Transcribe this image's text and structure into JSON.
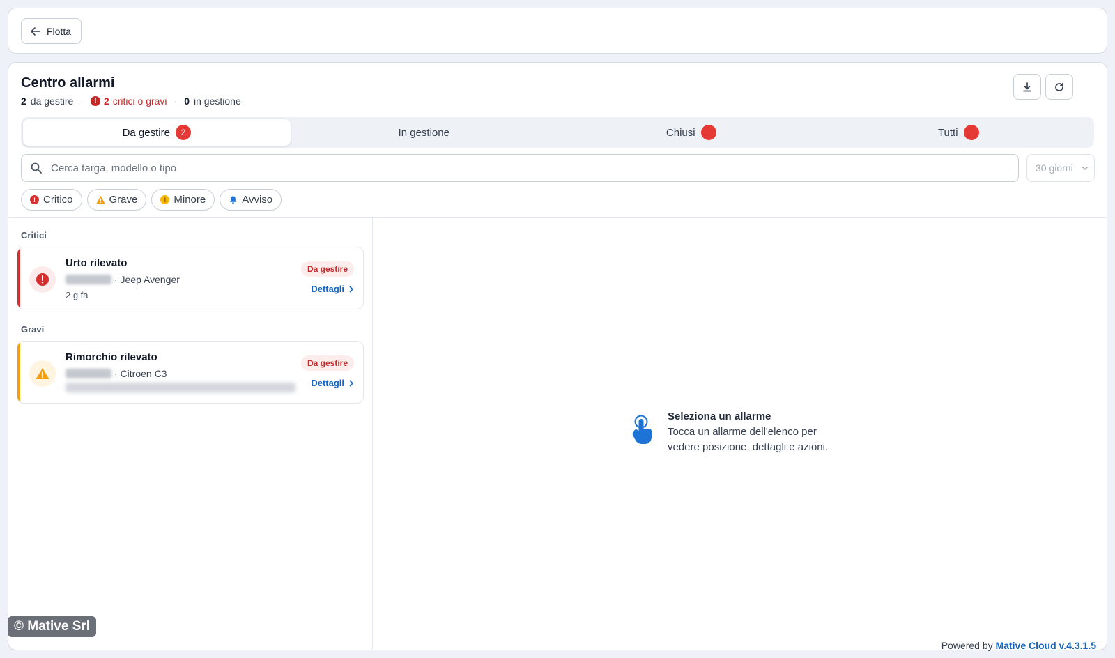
{
  "header": {
    "back_label": "Flotta"
  },
  "page": {
    "title": "Centro allarmi",
    "summary": {
      "to_handle_count": "2",
      "to_handle_label": "da gestire",
      "critical_count": "2",
      "critical_label": "critici o gravi",
      "in_progress_count": "0",
      "in_progress_label": "in gestione"
    },
    "actions": {
      "download_icon": "download-icon",
      "refresh_icon": "refresh-icon"
    }
  },
  "tabs": [
    {
      "label": "Da gestire",
      "badge": "2",
      "active": true
    },
    {
      "label": "In gestione",
      "badge": "",
      "active": false
    },
    {
      "label": "Chiusi",
      "badge": "",
      "active": false
    },
    {
      "label": "Tutti",
      "badge": "",
      "active": false
    }
  ],
  "search": {
    "placeholder": "Cerca targa, modello o tipo",
    "value": ""
  },
  "period": {
    "selected": "30 giorni"
  },
  "filters": [
    {
      "label": "Critico",
      "icon": "critical-icon"
    },
    {
      "label": "Grave",
      "icon": "warning-icon"
    },
    {
      "label": "Minore",
      "icon": "minor-icon"
    },
    {
      "label": "Avviso",
      "icon": "bell-icon"
    }
  ],
  "groups": [
    {
      "label": "Critici",
      "alarm": {
        "title": "Urto rilevato",
        "vehicle": "· Jeep Avenger",
        "time": "2 g fa",
        "status": "Da gestire",
        "details_label": "Dettagli"
      }
    },
    {
      "label": "Gravi",
      "alarm": {
        "title": "Rimorchio rilevato",
        "vehicle": "· Citroen C3",
        "status": "Da gestire",
        "details_label": "Dettagli"
      }
    }
  ],
  "empty_state": {
    "icon": "hand-pointer-icon",
    "title": "Seleziona un allarme",
    "description": "Tocca un allarme dell'elenco per vedere posizione, dettagli e azioni."
  },
  "footer": {
    "copyright": "© Mative Srl",
    "powered_prefix": "Powered by",
    "powered_brand": "Mative Cloud v.4.3.1.5"
  },
  "colors": {
    "critical": "#d32f2f",
    "serious": "#f59e0b",
    "badge": "#e53935",
    "link": "#1565c0"
  }
}
